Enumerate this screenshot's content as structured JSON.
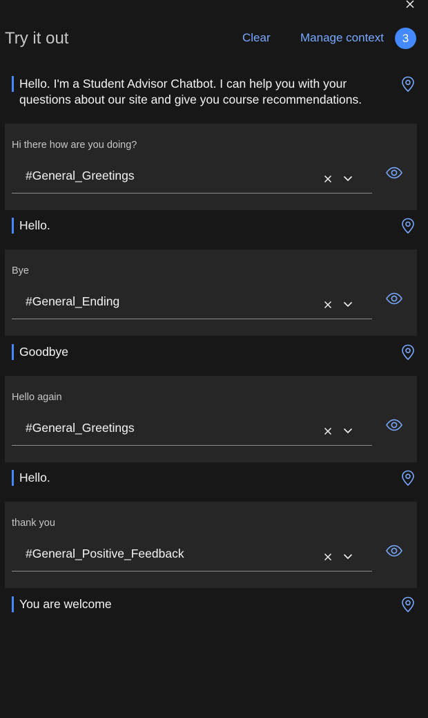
{
  "header": {
    "title": "Try it out",
    "clear_label": "Clear",
    "manage_label": "Manage context",
    "context_count": "3"
  },
  "messages": [
    {
      "type": "bot",
      "text": "Hello. I'm a Student Advisor Chatbot. I can help you with your questions about our site and give you course recommendations."
    },
    {
      "type": "user",
      "text": "Hi there how are you doing?",
      "intent": "#General_Greetings"
    },
    {
      "type": "bot",
      "text": "Hello."
    },
    {
      "type": "user",
      "text": "Bye",
      "intent": "#General_Ending"
    },
    {
      "type": "bot",
      "text": "Goodbye"
    },
    {
      "type": "user",
      "text": "Hello again",
      "intent": "#General_Greetings"
    },
    {
      "type": "bot",
      "text": "Hello."
    },
    {
      "type": "user",
      "text": "thank you",
      "intent": "#General_Positive_Feedback"
    },
    {
      "type": "bot",
      "text": "You are welcome"
    }
  ],
  "icons": {
    "close": "close-icon",
    "pin": "location-pin-icon",
    "eye": "eye-icon",
    "clear_selection": "close-icon",
    "dropdown": "chevron-down-icon"
  },
  "colors": {
    "background": "#171717",
    "panel": "#262626",
    "accent": "#78a9ff",
    "badge": "#4589ff"
  }
}
